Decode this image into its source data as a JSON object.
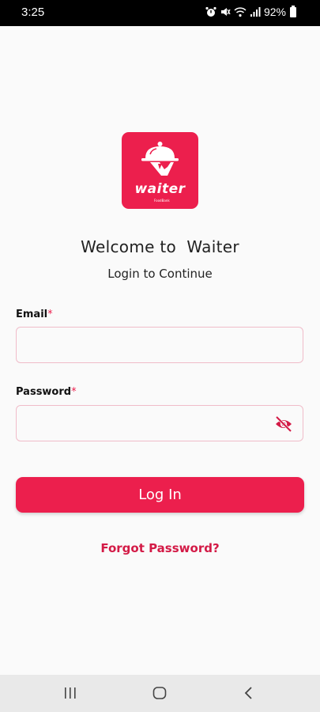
{
  "status_bar": {
    "time": "3:25",
    "battery": "92%"
  },
  "logo": {
    "word": "waiter",
    "sub": "FoodBank",
    "color": "#ec1f4d"
  },
  "header": {
    "title": "Welcome to  Waiter",
    "subtitle": "Login to Continue"
  },
  "form": {
    "email_label": "Email",
    "email_value": "",
    "password_label": "Password",
    "password_value": "",
    "required_mark": "*",
    "password_toggle_icon": "eye-off-icon"
  },
  "actions": {
    "login_label": "Log In",
    "forgot_label": "Forgot Password?"
  },
  "nav": {
    "icons": [
      "recent-apps-icon",
      "home-icon",
      "back-icon"
    ]
  }
}
